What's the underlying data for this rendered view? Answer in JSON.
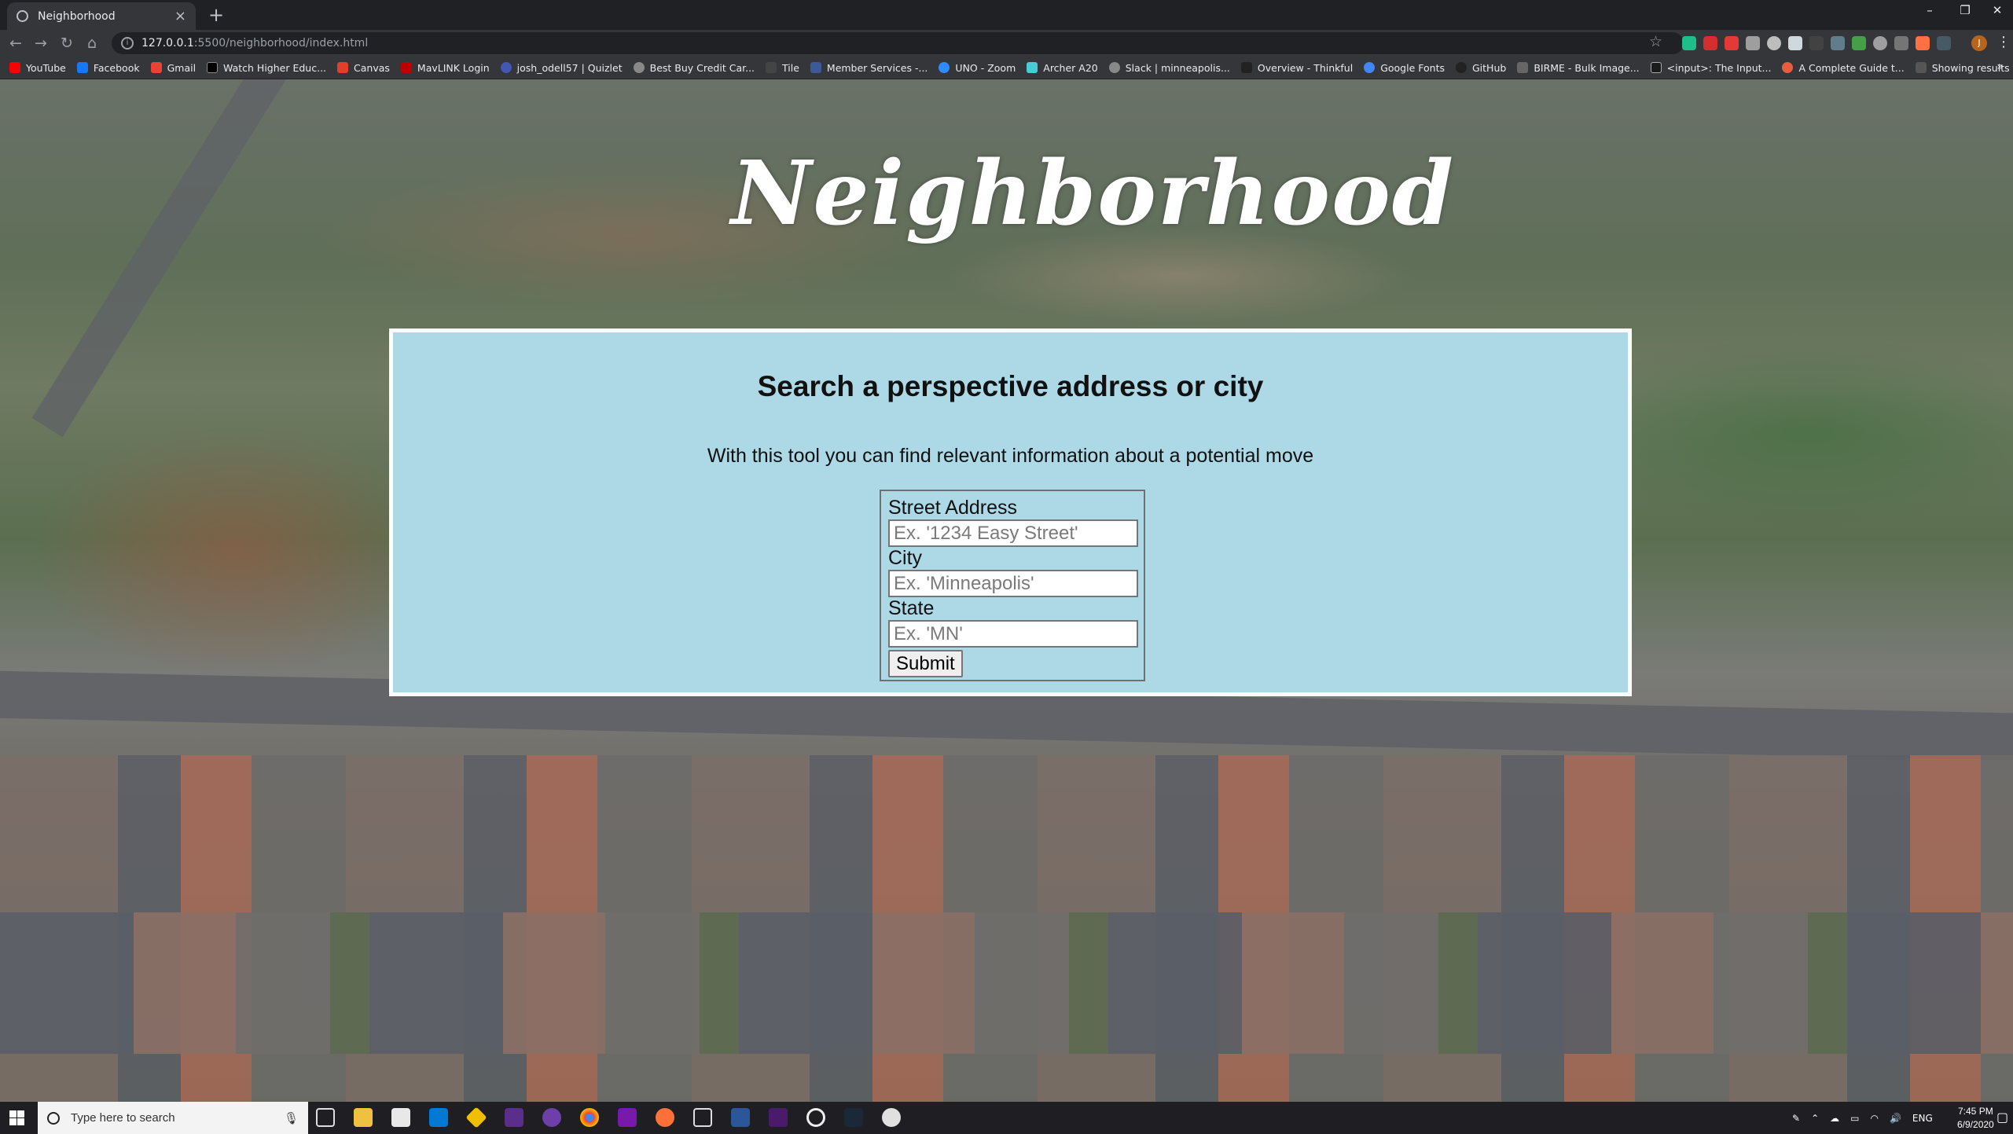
{
  "browser": {
    "tab_title": "Neighborhood",
    "tab_close": "×",
    "new_tab": "+",
    "url_host": "127.0.0.1",
    "url_rest": ":5500/neighborhood/index.html",
    "window_controls": [
      "–",
      "❐",
      "✕"
    ],
    "bookmarks": [
      {
        "label": "YouTube",
        "color": "#ff0000"
      },
      {
        "label": "Facebook",
        "color": "#1877f2"
      },
      {
        "label": "Gmail",
        "color": "#ea4335"
      },
      {
        "label": "Watch Higher Educ...",
        "color": "#000000"
      },
      {
        "label": "Canvas",
        "color": "#e13f2b"
      },
      {
        "label": "MavLINK Login",
        "color": "#c00000"
      },
      {
        "label": "josh_odell57 | Quizlet",
        "color": "#4257b2"
      },
      {
        "label": "Best Buy Credit Car...",
        "color": "#888888"
      },
      {
        "label": "Tile",
        "color": "#444444"
      },
      {
        "label": "Member Services -...",
        "color": "#3c5a99"
      },
      {
        "label": "UNO - Zoom",
        "color": "#2d8cff"
      },
      {
        "label": "Archer A20",
        "color": "#4acbd6"
      },
      {
        "label": "Slack | minneapolis...",
        "color": "#888888"
      },
      {
        "label": "Overview - Thinkful",
        "color": "#222222"
      },
      {
        "label": "Google Fonts",
        "color": "#4285f4"
      },
      {
        "label": "GitHub",
        "color": "#222222"
      },
      {
        "label": "BIRME - Bulk Image...",
        "color": "#666666"
      },
      {
        "label": "<input>: The Input...",
        "color": "#1b1b1b"
      },
      {
        "label": "A Complete Guide t...",
        "color": "#e85d3d"
      },
      {
        "label": "Showing results for...",
        "color": "#555555"
      }
    ],
    "bookmarks_more": "»"
  },
  "page": {
    "site_title": "Neighborhood",
    "heading": "Search a perspective address or city",
    "subheading": "With this tool you can find relevant information about a potential move",
    "form": {
      "street_label": "Street Address",
      "street_placeholder": "Ex. '1234 Easy Street'",
      "city_label": "City",
      "city_placeholder": "Ex. 'Minneapolis'",
      "state_label": "State",
      "state_placeholder": "Ex. 'MN'",
      "submit_label": "Submit"
    }
  },
  "taskbar": {
    "search_placeholder": "Type here to search",
    "language": "ENG",
    "time": "7:45 PM",
    "date": "6/9/2020"
  },
  "colors": {
    "card_background": "#add8e6",
    "card_border": "#ffffff"
  }
}
